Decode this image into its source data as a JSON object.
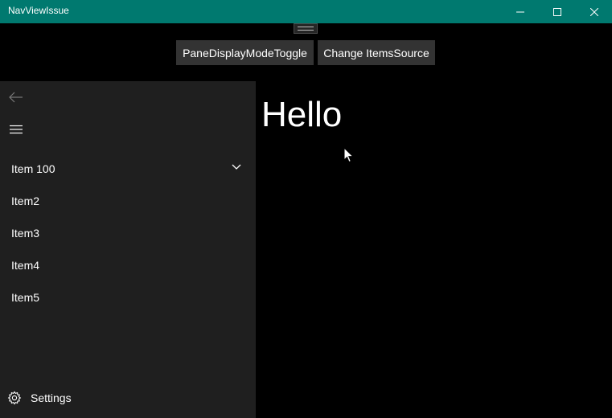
{
  "window": {
    "title": "NavViewIssue",
    "accent_color": "#00796f"
  },
  "titlebar_buttons": {
    "minimize_icon": "minimize-icon",
    "maximize_icon": "maximize-icon",
    "close_icon": "close-icon"
  },
  "toolbar": {
    "pane_toggle_label": "PaneDisplayModeToggle",
    "change_items_label": "Change ItemsSource"
  },
  "nav": {
    "back_icon": "back-arrow-icon",
    "menu_icon": "hamburger-menu-icon",
    "items": [
      {
        "label": "Item 100",
        "has_children": true
      },
      {
        "label": "Item2"
      },
      {
        "label": "Item3"
      },
      {
        "label": "Item4"
      },
      {
        "label": "Item5"
      }
    ],
    "settings_label": "Settings",
    "pane_color": "#1f1f1f"
  },
  "content": {
    "heading": "Hello"
  }
}
